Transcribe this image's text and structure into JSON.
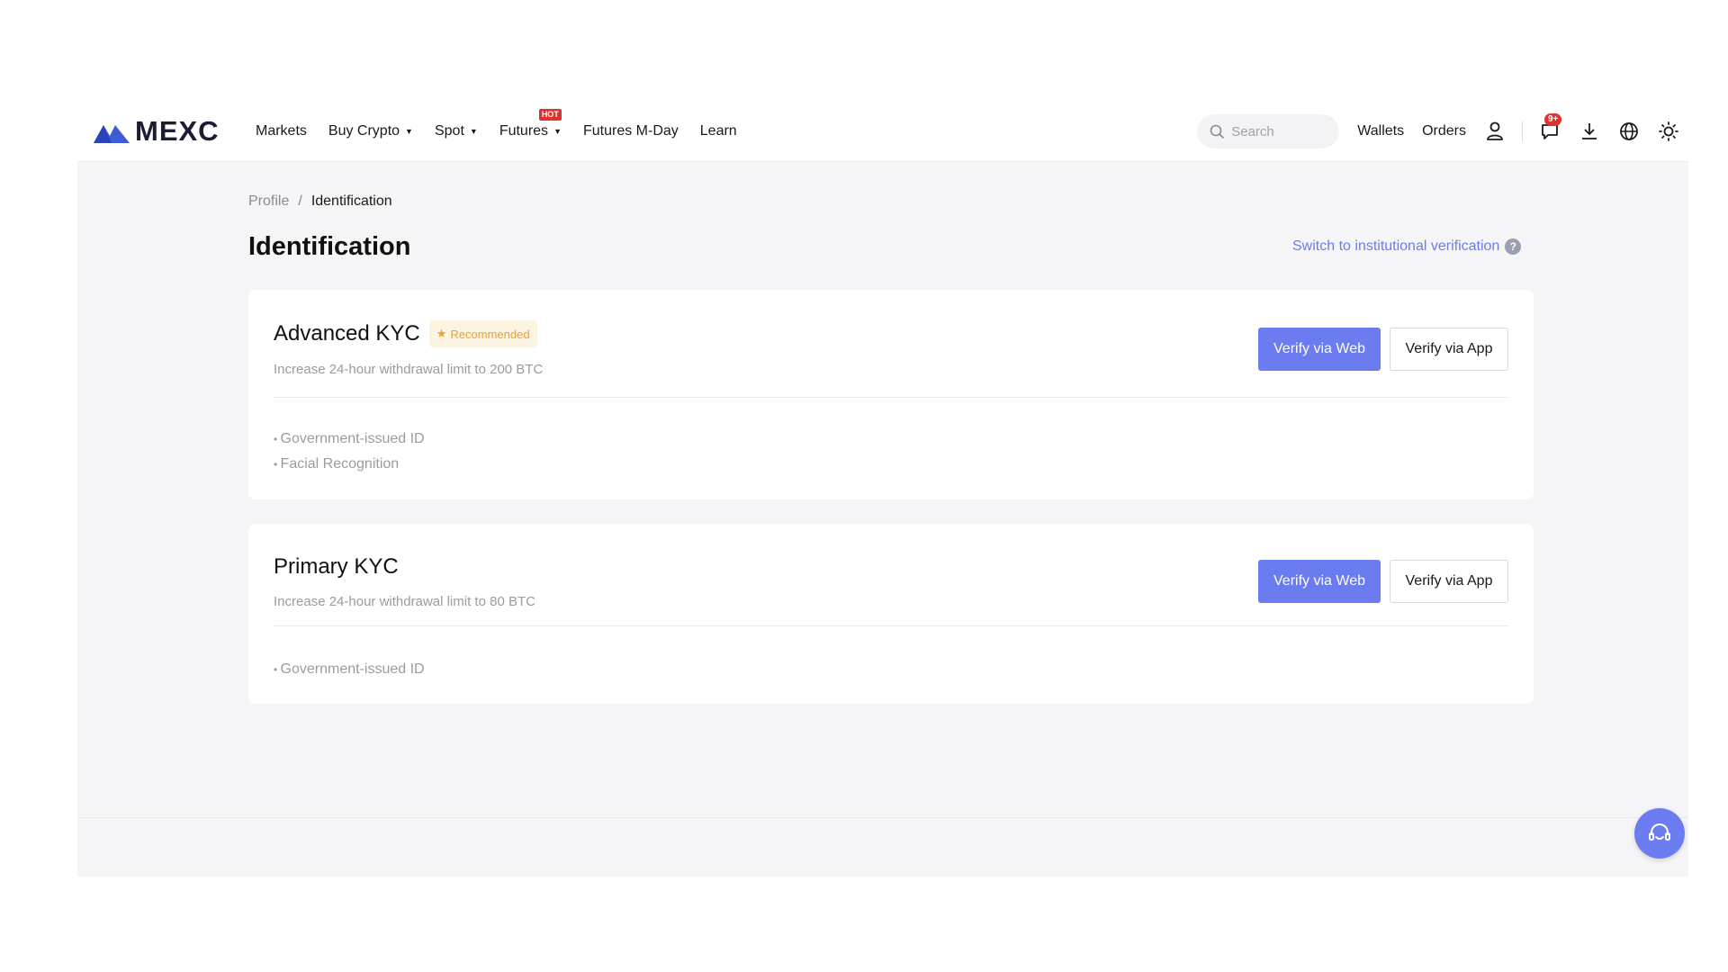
{
  "brand": {
    "name": "MEXC",
    "accent": "#6b7cf0"
  },
  "nav": {
    "items": [
      {
        "label": "Markets"
      },
      {
        "label": "Buy Crypto"
      },
      {
        "label": "Spot"
      },
      {
        "label": "Futures",
        "badge": "HOT"
      },
      {
        "label": "Futures M-Day"
      },
      {
        "label": "Learn"
      }
    ],
    "search_placeholder": "Search",
    "wallets": "Wallets",
    "orders": "Orders",
    "notif_count": "9+"
  },
  "breadcrumb": {
    "parent": "Profile",
    "separator": "/",
    "current": "Identification"
  },
  "page": {
    "title": "Identification",
    "institutional_link": "Switch to institutional verification",
    "help_glyph": "?"
  },
  "cards": [
    {
      "title": "Advanced KYC",
      "badge": "Recommended",
      "subtitle": "Increase 24-hour withdrawal limit to 200 BTC",
      "primary_btn": "Verify via Web",
      "secondary_btn": "Verify via App",
      "requirements": [
        "Government-issued ID",
        "Facial Recognition"
      ]
    },
    {
      "title": "Primary KYC",
      "subtitle": "Increase 24-hour withdrawal limit to 80 BTC",
      "primary_btn": "Verify via Web",
      "secondary_btn": "Verify via App",
      "requirements": [
        "Government-issued ID"
      ]
    }
  ],
  "icons": [
    "search-icon",
    "user-icon",
    "chat-icon",
    "download-icon",
    "globe-icon",
    "sun-icon",
    "star-icon",
    "headset-icon",
    "chevron-down-icon"
  ]
}
